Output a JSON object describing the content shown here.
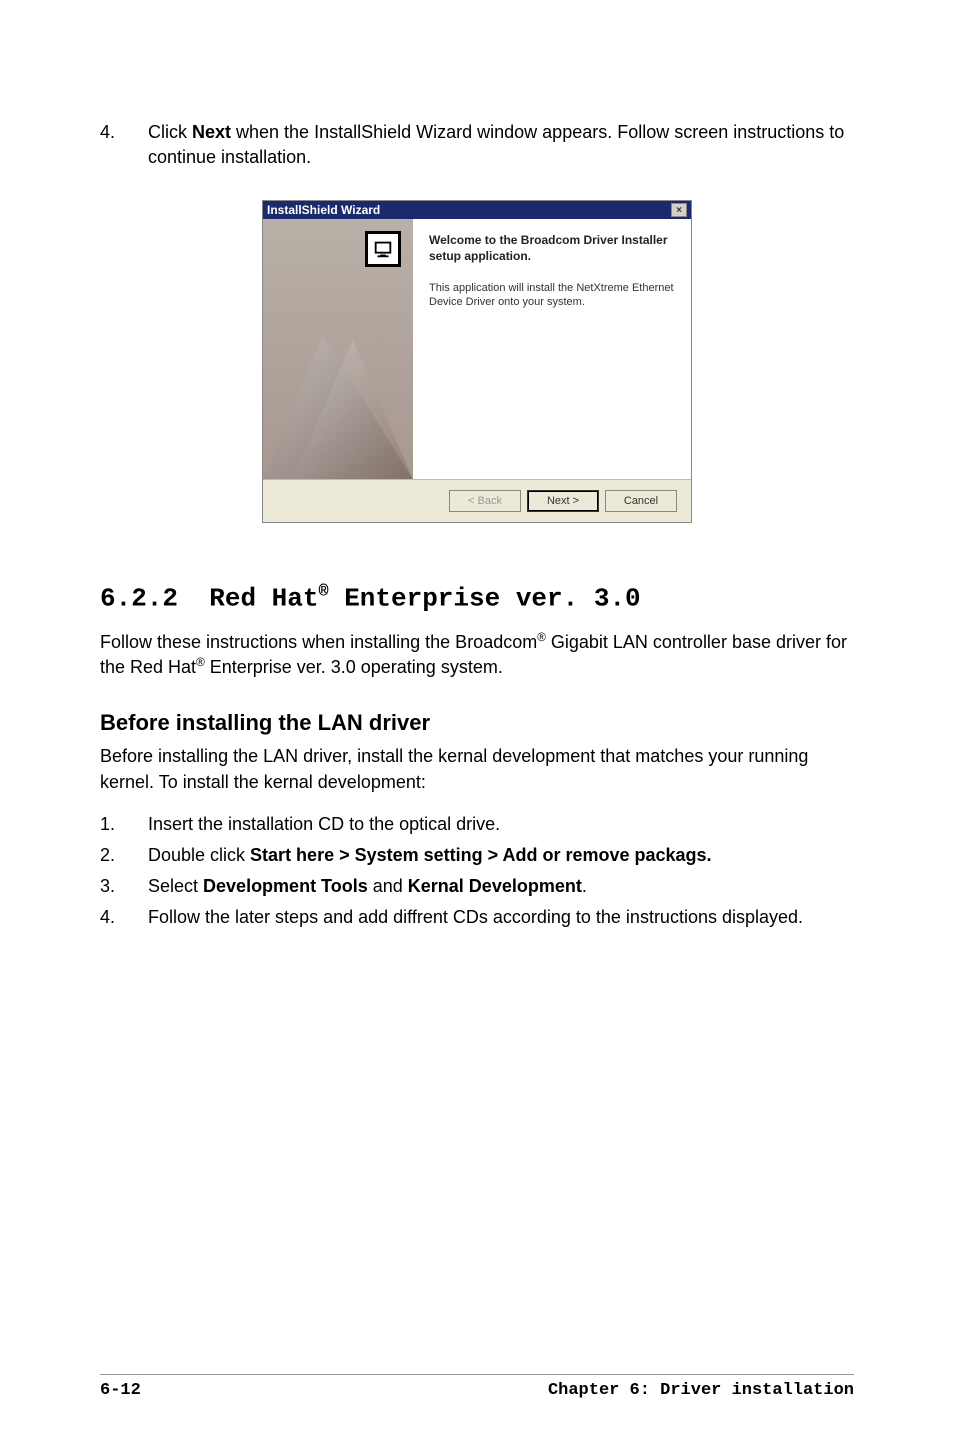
{
  "step4": {
    "num": "4.",
    "pre": "Click ",
    "bold": "Next",
    "post": " when the InstallShield Wizard window appears. Follow screen instructions to continue installation."
  },
  "wizard": {
    "title": "InstallShield Wizard",
    "close": "×",
    "welcome": "Welcome to the Broadcom Driver Installer setup application.",
    "desc": "This application will install the NetXtreme Ethernet Device Driver onto your system.",
    "back": "< Back",
    "next": "Next >",
    "cancel": "Cancel"
  },
  "section622": {
    "heading_num": "6.2.2",
    "heading_text": "Red Hat",
    "heading_sup": "®",
    "heading_post": " Enterprise ver. 3.0",
    "para_pre": "Follow these instructions when installing the Broadcom",
    "para_mid": " Gigabit LAN controller base driver for the Red Hat",
    "para_post": " Enterprise ver. 3.0 operating system."
  },
  "before": {
    "heading": "Before installing the LAN driver",
    "para": "Before installing the LAN driver, install the kernal development that matches your running kernel. To install the kernal development:",
    "steps": [
      {
        "num": "1.",
        "text": "Insert the installation CD to the optical drive."
      },
      {
        "num": "2.",
        "pre": "Double click ",
        "bold": "Start here > System setting > Add or remove packags."
      },
      {
        "num": "3.",
        "pre": "Select ",
        "bold1": "Development Tools",
        "mid": " and ",
        "bold2": "Kernal Development",
        "post": "."
      },
      {
        "num": "4.",
        "text": "Follow the later steps and add diffrent CDs according to the instructions displayed."
      }
    ]
  },
  "footer": {
    "left": "6-12",
    "right": "Chapter 6: Driver installation"
  }
}
